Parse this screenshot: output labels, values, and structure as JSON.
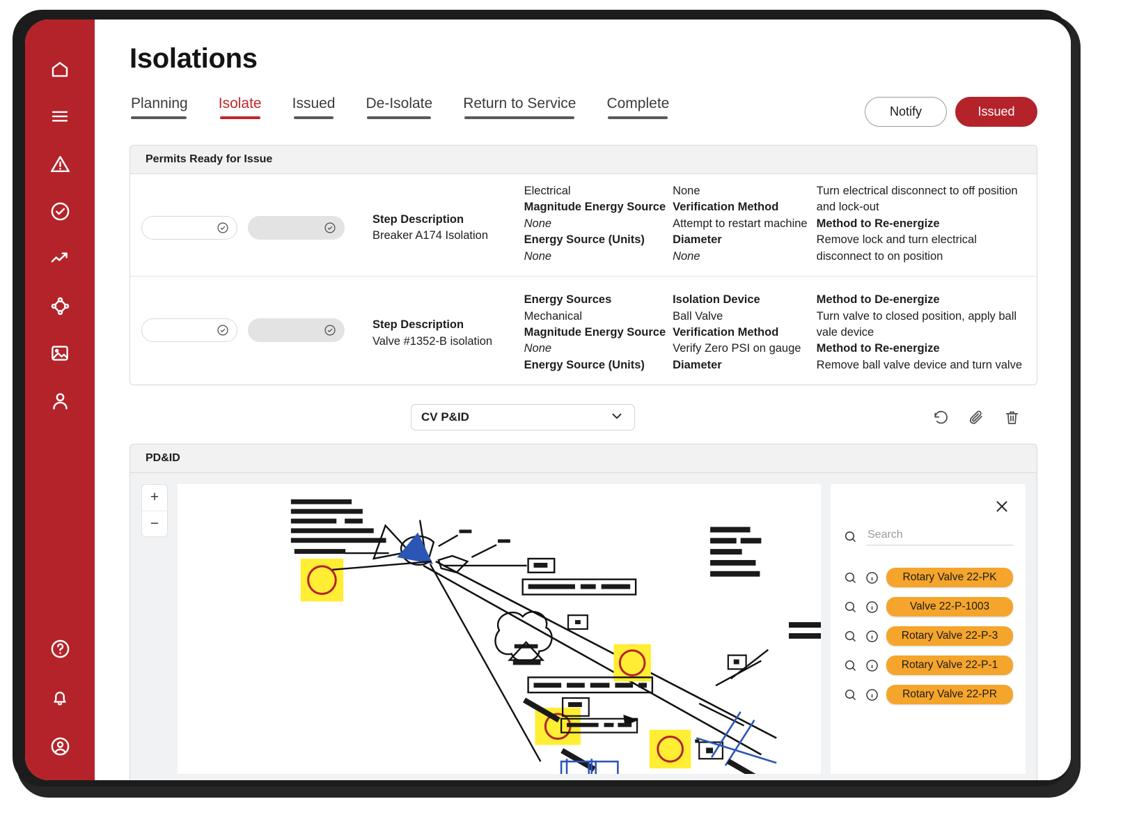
{
  "sidebar": {
    "items": [
      {
        "icon": "home-icon",
        "name": "sidebar-item-home"
      },
      {
        "icon": "menu-icon",
        "name": "sidebar-item-menu"
      },
      {
        "icon": "warning-icon",
        "name": "sidebar-item-alerts"
      },
      {
        "icon": "check-circle-icon",
        "name": "sidebar-item-tasks"
      },
      {
        "icon": "trend-up-icon",
        "name": "sidebar-item-analytics"
      },
      {
        "icon": "nodes-icon",
        "name": "sidebar-item-network"
      },
      {
        "icon": "image-icon",
        "name": "sidebar-item-media"
      },
      {
        "icon": "user-icon",
        "name": "sidebar-item-profile"
      }
    ],
    "bottom_items": [
      {
        "icon": "help-circle-icon",
        "name": "sidebar-item-help"
      },
      {
        "icon": "bell-icon",
        "name": "sidebar-item-notifications"
      },
      {
        "icon": "account-circle-icon",
        "name": "sidebar-item-account"
      }
    ],
    "color": "#b4232a"
  },
  "header": {
    "title": "Isolations"
  },
  "tabs": [
    {
      "label": "Planning",
      "active": false
    },
    {
      "label": "Isolate",
      "active": true
    },
    {
      "label": "Issued",
      "active": false
    },
    {
      "label": "De-Isolate",
      "active": false
    },
    {
      "label": "Return to Service",
      "active": false
    },
    {
      "label": "Complete",
      "active": false
    }
  ],
  "actions": {
    "notify_label": "Notify",
    "issued_label": "Issued",
    "accent_color": "#b4232a"
  },
  "permits_card": {
    "header": "Permits Ready for Issue",
    "rows": [
      {
        "step_label": "Step Description",
        "step_value": "Breaker A174 Isolation",
        "energy": [
          {
            "text": "Electrical",
            "style": "normal"
          },
          {
            "text": "Magnitude Energy Source",
            "style": "bold"
          },
          {
            "text": "None",
            "style": "italic"
          },
          {
            "text": "Energy Source (Units)",
            "style": "bold"
          },
          {
            "text": "None",
            "style": "italic"
          }
        ],
        "isolation": [
          {
            "text": "None",
            "style": "normal"
          },
          {
            "text": "Verification Method",
            "style": "bold"
          },
          {
            "text": "Attempt to restart machine",
            "style": "normal"
          },
          {
            "text": "Diameter",
            "style": "bold"
          },
          {
            "text": "None",
            "style": "italic"
          }
        ],
        "method": [
          {
            "text": "Turn electrical disconnect to off position and lock-out",
            "style": "normal"
          },
          {
            "text": "Method to Re-energize",
            "style": "bold"
          },
          {
            "text": "Remove lock and turn electrical disconnect to on position",
            "style": "normal"
          }
        ]
      },
      {
        "step_label": "Step Description",
        "step_value": "Valve #1352-B isolation",
        "energy": [
          {
            "text": "Energy Sources",
            "style": "bold"
          },
          {
            "text": "Mechanical",
            "style": "normal"
          },
          {
            "text": "Magnitude Energy Source",
            "style": "bold"
          },
          {
            "text": "None",
            "style": "italic"
          },
          {
            "text": "Energy Source (Units)",
            "style": "bold"
          }
        ],
        "isolation": [
          {
            "text": "Isolation Device",
            "style": "bold"
          },
          {
            "text": "Ball Valve",
            "style": "normal"
          },
          {
            "text": "Verification Method",
            "style": "bold"
          },
          {
            "text": "Verify Zero PSI on gauge",
            "style": "normal"
          },
          {
            "text": "Diameter",
            "style": "bold"
          }
        ],
        "method": [
          {
            "text": "Method to De-energize",
            "style": "bold"
          },
          {
            "text": "Turn valve to closed position, apply ball vale device",
            "style": "normal"
          },
          {
            "text": "Method to Re-energize",
            "style": "bold"
          },
          {
            "text": "Remove ball valve device and turn valve",
            "style": "normal"
          }
        ]
      }
    ]
  },
  "drawing_select": {
    "value": "CV P&ID",
    "chevron_icon": "chevron-down-icon"
  },
  "toolbar_icons": [
    {
      "icon": "history-revert-icon",
      "name": "revision-history-button"
    },
    {
      "icon": "paperclip-icon",
      "name": "attachment-button"
    },
    {
      "icon": "trash-icon",
      "name": "delete-button"
    }
  ],
  "pid_panel": {
    "header": "PD&ID",
    "zoom_in": "+",
    "zoom_out": "−",
    "close_icon": "close-icon",
    "search": {
      "placeholder": "Search",
      "value": "",
      "icon": "search-icon"
    },
    "valves": [
      {
        "label": "Rotary Valve 22-PK",
        "color": "#f5a52b"
      },
      {
        "label": "Valve 22-P-1003",
        "color": "#f5a52b"
      },
      {
        "label": "Rotary Valve 22-P-3",
        "color": "#f5a52b"
      },
      {
        "label": "Rotary Valve 22-P-1",
        "color": "#f5a52b"
      },
      {
        "label": "Rotary Valve 22-PR",
        "color": "#f5a52b"
      }
    ],
    "item_icons": {
      "search": "search-icon",
      "info": "info-circle-icon"
    },
    "highlight_color": "#ffee33",
    "marker_color": "#b4232a"
  }
}
